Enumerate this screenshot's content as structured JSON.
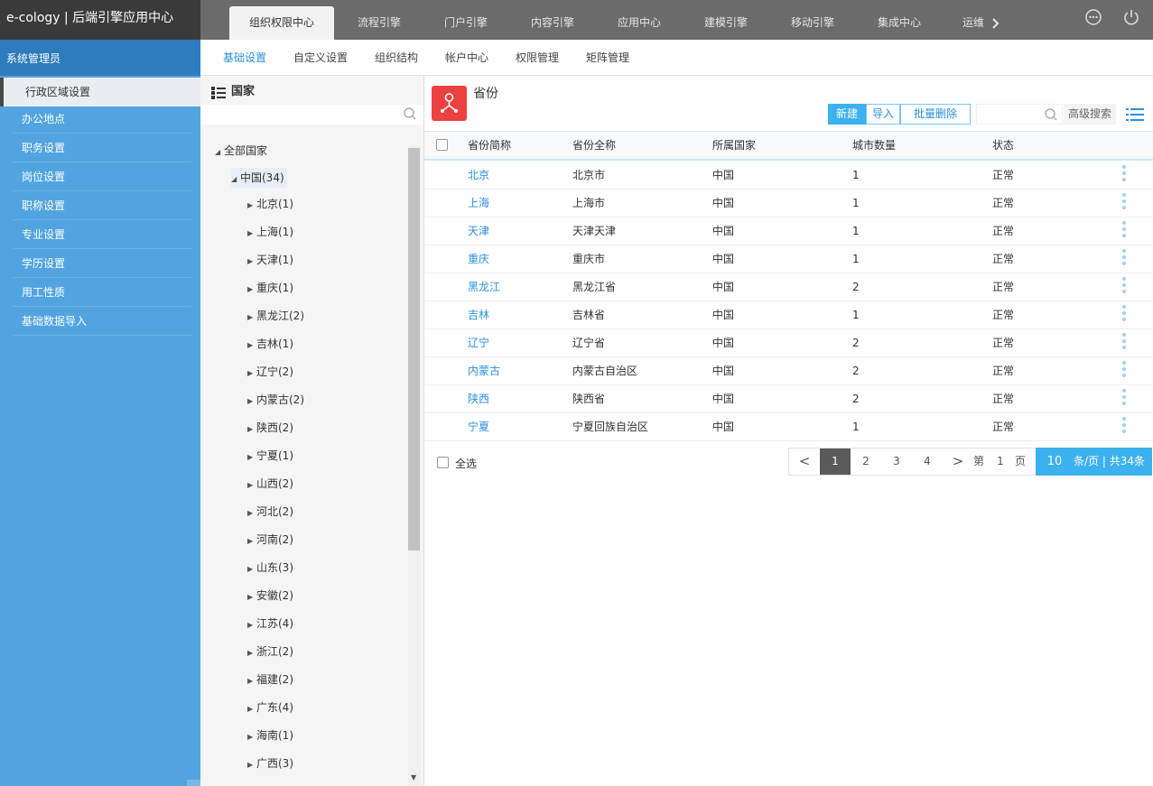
{
  "app": {
    "title": "e-cology | 后端引擎应用中心"
  },
  "top_nav": [
    {
      "label": "组织权限中心",
      "active": true
    },
    {
      "label": "流程引擎"
    },
    {
      "label": "门户引擎"
    },
    {
      "label": "内容引擎"
    },
    {
      "label": "应用中心"
    },
    {
      "label": "建模引擎"
    },
    {
      "label": "移动引擎"
    },
    {
      "label": "集成中心"
    },
    {
      "label": "运维"
    }
  ],
  "top_icons": [
    "more-icon",
    "power-icon"
  ],
  "sidebar": {
    "header": "系统管理员",
    "items": [
      {
        "label": "行政区域设置",
        "active": true
      },
      {
        "label": "办公地点"
      },
      {
        "label": "职务设置"
      },
      {
        "label": "岗位设置"
      },
      {
        "label": "职称设置"
      },
      {
        "label": "专业设置"
      },
      {
        "label": "学历设置"
      },
      {
        "label": "用工性质"
      },
      {
        "label": "基础数据导入"
      }
    ]
  },
  "sub_nav": [
    {
      "label": "基础设置",
      "active": true
    },
    {
      "label": "自定义设置"
    },
    {
      "label": "组织结构"
    },
    {
      "label": "帐户中心"
    },
    {
      "label": "权限管理"
    },
    {
      "label": "矩阵管理"
    }
  ],
  "tree": {
    "title": "国家",
    "root": "全部国家",
    "country": "中国(34)",
    "provinces": [
      "北京(1)",
      "上海(1)",
      "天津(1)",
      "重庆(1)",
      "黑龙江(2)",
      "吉林(1)",
      "辽宁(2)",
      "内蒙古(2)",
      "陕西(2)",
      "宁夏(1)",
      "山西(2)",
      "河北(2)",
      "河南(2)",
      "山东(3)",
      "安徽(2)",
      "江苏(4)",
      "浙江(2)",
      "福建(2)",
      "广东(4)",
      "海南(1)",
      "广西(3)"
    ]
  },
  "main": {
    "title": "省份",
    "buttons": {
      "new": "新建",
      "import": "导入",
      "batch_delete": "批量删除"
    },
    "search": {
      "placeholder": "",
      "advanced": "高级搜索"
    },
    "columns": [
      "省份简称",
      "省份全称",
      "所属国家",
      "城市数量",
      "状态"
    ],
    "rows": [
      [
        "北京",
        "北京市",
        "中国",
        "1",
        "正常"
      ],
      [
        "上海",
        "上海市",
        "中国",
        "1",
        "正常"
      ],
      [
        "天津",
        "天津天津",
        "中国",
        "1",
        "正常"
      ],
      [
        "重庆",
        "重庆市",
        "中国",
        "1",
        "正常"
      ],
      [
        "黑龙江",
        "黑龙江省",
        "中国",
        "2",
        "正常"
      ],
      [
        "吉林",
        "吉林省",
        "中国",
        "1",
        "正常"
      ],
      [
        "辽宁",
        "辽宁省",
        "中国",
        "2",
        "正常"
      ],
      [
        "内蒙古",
        "内蒙古自治区",
        "中国",
        "2",
        "正常"
      ],
      [
        "陕西",
        "陕西省",
        "中国",
        "2",
        "正常"
      ],
      [
        "宁夏",
        "宁夏回族自治区",
        "中国",
        "1",
        "正常"
      ]
    ],
    "select_all": "全选",
    "pager": {
      "prev": "<",
      "pages": [
        "1",
        "2",
        "3",
        "4"
      ],
      "current": "1",
      "next": ">",
      "goto_prefix": "第",
      "goto_value": "1",
      "goto_suffix": "页",
      "page_size": "10",
      "summary": "条/页 | 共34条"
    }
  },
  "colors": {
    "accent": "#3cb1f0",
    "link": "#2b8fe0",
    "sidebar": "#52a4e0",
    "sidebar_header": "#2e7bbd",
    "topbar": "#6b6b6b",
    "module_icon": "#ed4040"
  }
}
